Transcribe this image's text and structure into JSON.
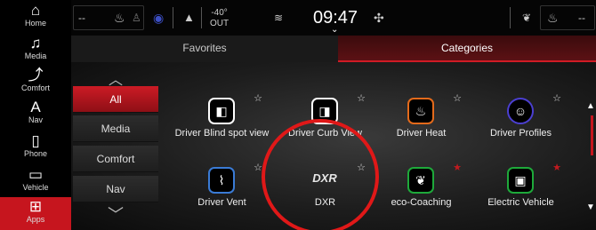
{
  "nav": {
    "items": [
      {
        "label": "Home",
        "icon": "home-icon"
      },
      {
        "label": "Media",
        "icon": "music-note-icon"
      },
      {
        "label": "Comfort",
        "icon": "seat-icon"
      },
      {
        "label": "Nav",
        "icon": "navigation-arrow-icon"
      },
      {
        "label": "Phone",
        "icon": "phone-icon"
      },
      {
        "label": "Vehicle",
        "icon": "car-icon"
      },
      {
        "label": "Apps",
        "icon": "apps-grid-icon"
      }
    ],
    "active": "Apps"
  },
  "status": {
    "left_temp": "--",
    "outside_temp_value": "-40°",
    "outside_temp_label": "OUT",
    "time": "09:47",
    "right_temp": "--"
  },
  "tabs": {
    "favorites": "Favorites",
    "categories": "Categories"
  },
  "categories": {
    "items": [
      "All",
      "Media",
      "Comfort",
      "Nav"
    ],
    "selected": "All"
  },
  "apps": [
    {
      "label": "Driver Blind spot view",
      "icon": "blind-spot-icon",
      "favorite": false
    },
    {
      "label": "Driver Curb View",
      "icon": "curb-view-icon",
      "favorite": false
    },
    {
      "label": "Driver Heat",
      "icon": "heated-seat-icon",
      "favorite": false
    },
    {
      "label": "Driver Profiles",
      "icon": "profiles-icon",
      "favorite": false
    },
    {
      "label": "Driver Vent",
      "icon": "vented-seat-icon",
      "favorite": false
    },
    {
      "label": "DXR",
      "icon_text": "DXR",
      "favorite": false
    },
    {
      "label": "eco-Coaching",
      "icon": "leaf-icon",
      "favorite": true
    },
    {
      "label": "Electric Vehicle",
      "icon": "ev-icon",
      "favorite": true
    }
  ],
  "colors": {
    "accent": "#c6151e",
    "highlight_ring": "#e01818"
  }
}
